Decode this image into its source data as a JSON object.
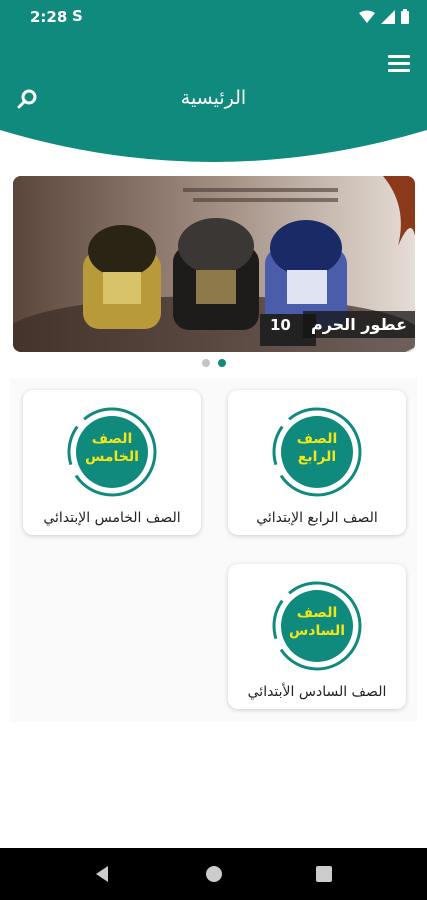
{
  "status_bar": {
    "time": "2:28",
    "notification": "S"
  },
  "header": {
    "title": "الرئيسية"
  },
  "banner": {
    "caption": "عطور الحرم",
    "badge_number": "10"
  },
  "carousel": {
    "count": 2,
    "active_index": 1
  },
  "cards": [
    {
      "label": "الصف الرابع الإبتدائي",
      "badge_line1": "الصف",
      "badge_line2": "الرابع"
    },
    {
      "label": "الصف الخامس الإبتدائي",
      "badge_line1": "الصف",
      "badge_line2": "الخامس"
    },
    {
      "label": "الصف السادس الأبتدائي",
      "badge_line1": "الصف",
      "badge_line2": "السادس"
    }
  ],
  "colors": {
    "primary": "#0f8a7c",
    "badge_text": "#f2e51a"
  }
}
